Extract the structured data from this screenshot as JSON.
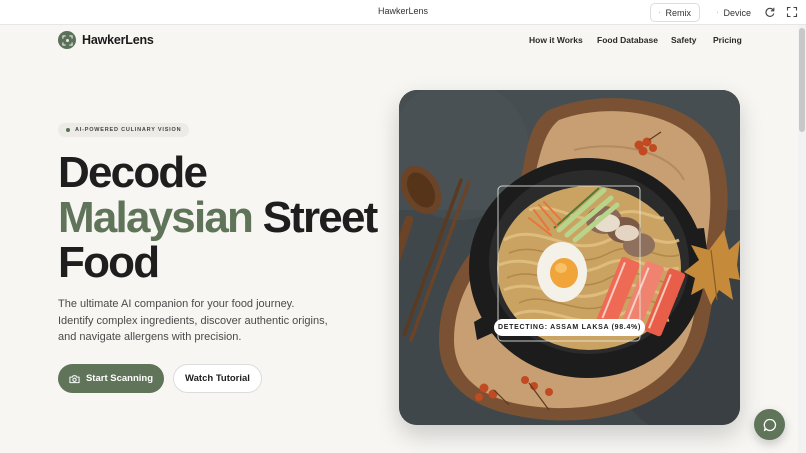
{
  "window": {
    "title": "HawkerLens",
    "remix_label": "Remix",
    "device_label": "Device"
  },
  "brand": {
    "name": "HawkerLens"
  },
  "nav": {
    "items": [
      "How it Works",
      "Food Database",
      "Safety",
      "Pricing"
    ]
  },
  "hero": {
    "badge": "AI-POWERED CULINARY VISION",
    "headline_1": "Decode",
    "headline_2_accent": "Malaysian",
    "headline_2_rest": "Street",
    "headline_3": "Food",
    "description": "The ultimate AI companion for your food journey. Identify complex ingredients, discover authentic origins, and navigate allergens with precision.",
    "primary_button": "Start Scanning",
    "secondary_button": "Watch Tutorial",
    "detection_label": "DETECTING: ASSAM LAKSA (98.4%)"
  },
  "colors": {
    "accent": "#5f7458",
    "background": "#f7f6f3",
    "text": "#1e1e1e"
  },
  "icons": [
    "remix-icon",
    "device-icon",
    "refresh-icon",
    "expand-icon",
    "logo-icon",
    "camera-icon",
    "chat-icon"
  ]
}
